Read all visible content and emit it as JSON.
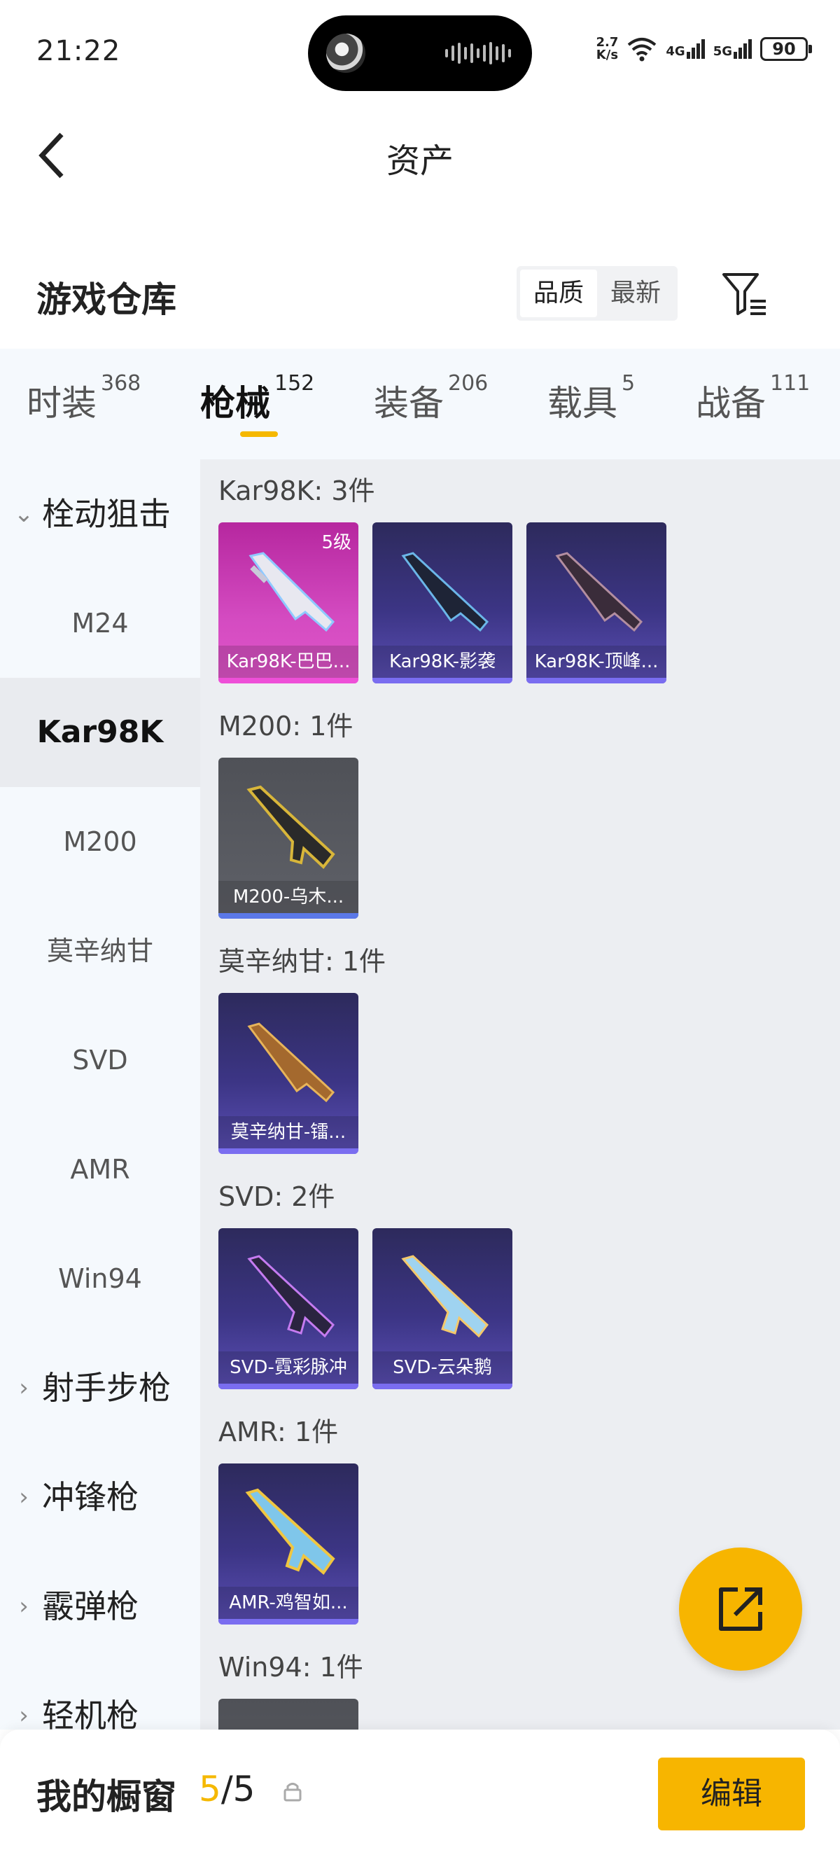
{
  "status_bar": {
    "time": "21:22",
    "net_speed_value": "2.7",
    "net_speed_unit": "K/s",
    "signal_1": "4G",
    "signal_2": "5G",
    "battery": "90"
  },
  "header": {
    "title": "资产",
    "back_icon": "chevron-left-icon"
  },
  "section": {
    "title": "游戏仓库",
    "sort_options": [
      "品质",
      "最新"
    ],
    "sort_selected": "品质",
    "filter_icon": "filter-icon"
  },
  "tabs": [
    {
      "label": "时装",
      "count": "368"
    },
    {
      "label": "枪械",
      "count": "152"
    },
    {
      "label": "装备",
      "count": "206"
    },
    {
      "label": "载具",
      "count": "5"
    },
    {
      "label": "战备",
      "count": "111"
    }
  ],
  "active_tab": "枪械",
  "sidebar": {
    "group_open": "栓动狙击",
    "items": [
      "M24",
      "Kar98K",
      "M200",
      "莫辛纳甘",
      "SVD",
      "AMR",
      "Win94"
    ],
    "active_item": "Kar98K",
    "groups_closed": [
      "射手步枪",
      "冲锋枪",
      "霰弹枪",
      "轻机枪"
    ]
  },
  "content": {
    "groups": [
      {
        "label": "Kar98K: 3件",
        "cards": [
          {
            "name": "Kar98K-巴巴...",
            "level": "5级",
            "rarity": "pink"
          },
          {
            "name": "Kar98K-影袭",
            "rarity": "purple"
          },
          {
            "name": "Kar98K-顶峰...",
            "rarity": "purple"
          }
        ]
      },
      {
        "label": "M200: 1件",
        "cards": [
          {
            "name": "M200-乌木...",
            "rarity": "gray"
          }
        ]
      },
      {
        "label": "莫辛纳甘: 1件",
        "cards": [
          {
            "name": "莫辛纳甘-镭...",
            "rarity": "purple"
          }
        ]
      },
      {
        "label": "SVD: 2件",
        "cards": [
          {
            "name": "SVD-霓彩脉冲",
            "rarity": "purple"
          },
          {
            "name": "SVD-云朵鹅",
            "rarity": "purple"
          }
        ]
      },
      {
        "label": "AMR: 1件",
        "cards": [
          {
            "name": "AMR-鸡智如...",
            "rarity": "purple"
          }
        ]
      },
      {
        "label": "Win94: 1件",
        "cards": []
      }
    ]
  },
  "fab": {
    "icon": "share-icon"
  },
  "bottom_bar": {
    "label": "我的橱窗",
    "count_current": "5",
    "count_total": "/5",
    "lock_icon": "lock-icon",
    "edit_label": "编辑"
  },
  "colors": {
    "accent": "#f7b500",
    "rarity_pink": "#d44bc1",
    "rarity_purple": "#3c3585",
    "rarity_gray": "#5f6168"
  }
}
